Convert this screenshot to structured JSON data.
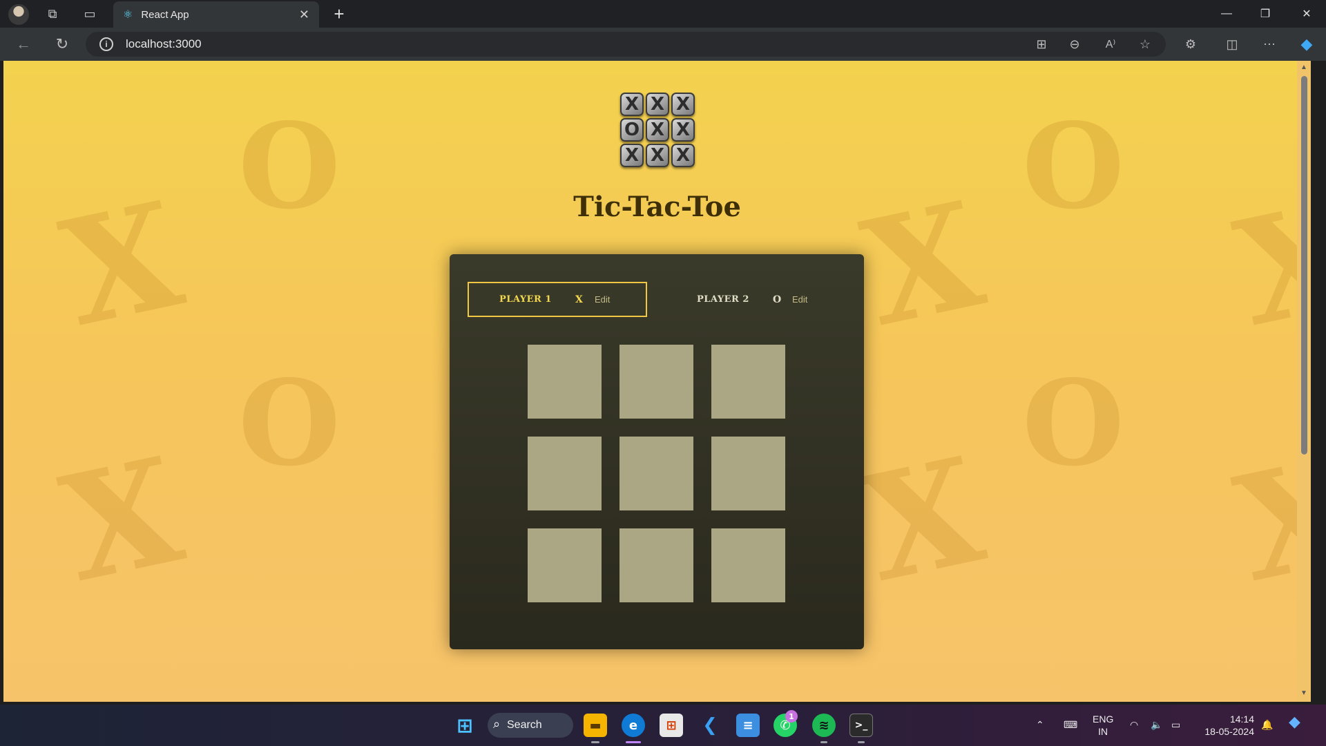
{
  "browser": {
    "tab_title": "React App",
    "url": "localhost:3000"
  },
  "page": {
    "title": "Tic-Tac-Toe",
    "logo_cells": [
      "X",
      "X",
      "X",
      "O",
      "X",
      "X",
      "X",
      "X",
      "X"
    ],
    "players": [
      {
        "name": "PLAYER 1",
        "symbol": "X",
        "edit_label": "Edit",
        "active": true
      },
      {
        "name": "PLAYER 2",
        "symbol": "O",
        "edit_label": "Edit",
        "active": false
      }
    ],
    "board": [
      [
        null,
        null,
        null
      ],
      [
        null,
        null,
        null
      ],
      [
        null,
        null,
        null
      ]
    ],
    "background_symbols": [
      "X",
      "O"
    ]
  },
  "taskbar": {
    "search_label": "Search",
    "whatsapp_badge": "1",
    "language": "ENG",
    "region": "IN",
    "time": "14:14",
    "date": "18-05-2024"
  },
  "colors": {
    "page_bg": "#f5c95a",
    "container_bg": "#2f2e22",
    "cell_bg": "#aba684",
    "active_border": "#f2c744",
    "title": "#3e2f07"
  }
}
